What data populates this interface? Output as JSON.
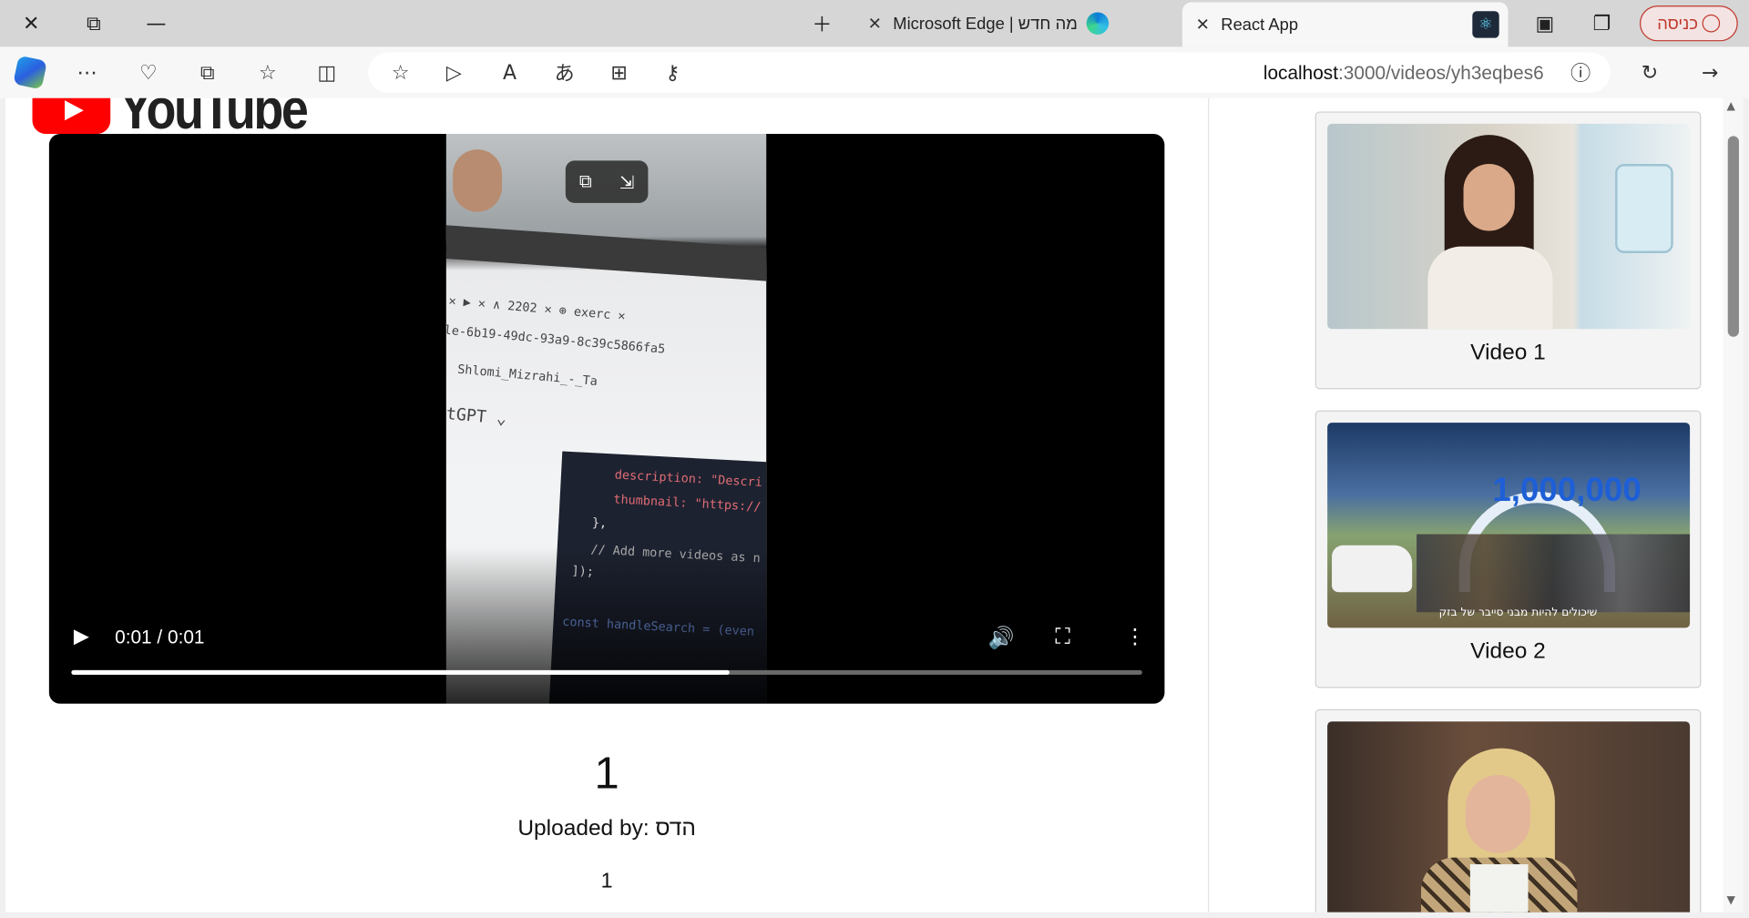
{
  "browser": {
    "tabs": [
      {
        "title": "Microsoft Edge | מה חדש",
        "active": false
      },
      {
        "title": "React App",
        "active": true
      }
    ],
    "login_label": "כניסה",
    "url_host": "localhost",
    "url_path": ":3000/videos/yh3eqbes6"
  },
  "page": {
    "logo_text": "YouTube",
    "player": {
      "time": "0:01 / 0:01",
      "progress_fraction": 0.615
    },
    "video": {
      "title": "1",
      "uploaded_by": "Uploaded by: הדס",
      "description": "1"
    },
    "sidebar": [
      {
        "label": "Video 1"
      },
      {
        "label": "Video 2"
      },
      {
        "label": ""
      }
    ]
  },
  "colors": {
    "youtube_red": "#ff0000",
    "login_red": "#c0392b"
  }
}
